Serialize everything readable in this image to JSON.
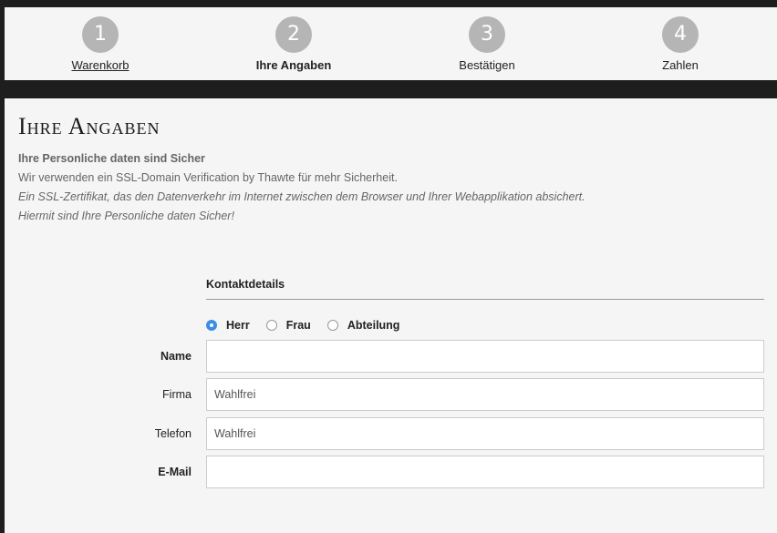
{
  "steps": [
    {
      "number": "1",
      "label": "Warenkorb"
    },
    {
      "number": "2",
      "label": "Ihre Angaben"
    },
    {
      "number": "3",
      "label": "Bestätigen"
    },
    {
      "number": "4",
      "label": "Zahlen"
    }
  ],
  "page": {
    "title": "Ihre Angaben",
    "intro_heading": "Ihre Personliche daten sind Sicher",
    "intro_line1": "Wir verwenden ein SSL-Domain Verification by Thawte für mehr Sicherheit.",
    "intro_line2": "Ein SSL-Zertifikat, das den Datenverkehr im Internet zwischen dem Browser und Ihrer Webapplikation absichert.",
    "intro_line3": "Hiermit sind Ihre Personliche daten Sicher!"
  },
  "form": {
    "section_title": "Kontaktdetails",
    "salutation": {
      "options": [
        "Herr",
        "Frau",
        "Abteilung"
      ],
      "selected": "Herr"
    },
    "fields": {
      "name": {
        "label": "Name",
        "value": "",
        "placeholder": ""
      },
      "firma": {
        "label": "Firma",
        "value": "",
        "placeholder": "Wahlfrei"
      },
      "telefon": {
        "label": "Telefon",
        "value": "",
        "placeholder": "Wahlfrei"
      },
      "email": {
        "label": "E-Mail",
        "value": "",
        "placeholder": ""
      }
    }
  },
  "colors": {
    "step_circle": "#b5b5b5",
    "radio_checked": "#3a8ee6",
    "background_dark": "#1e1e1e",
    "panel": "#f5f5f5"
  }
}
